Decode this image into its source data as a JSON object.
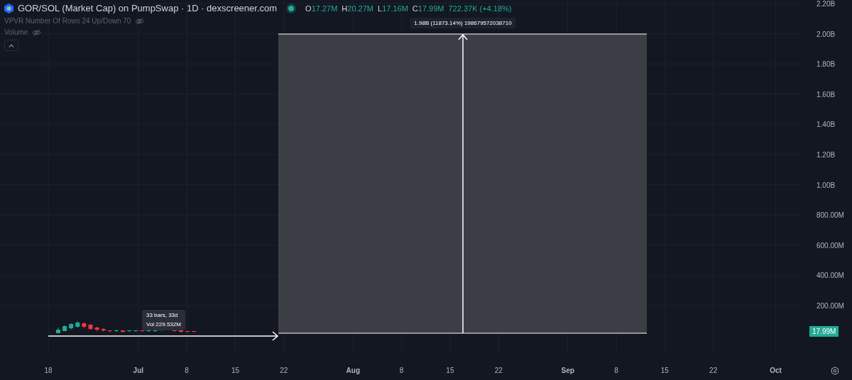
{
  "legend": {
    "title": "GOR/SOL (Market Cap) on PumpSwap · 1D · dexscreener.com",
    "ohlc": [
      {
        "label": "O",
        "value": "17.27M"
      },
      {
        "label": "H",
        "value": "20.27M"
      },
      {
        "label": "L",
        "value": "17.16M"
      },
      {
        "label": "C",
        "value": "17.99M"
      }
    ],
    "change": "722.37K (+4.18%)",
    "indicators": [
      "VPVR Number Of Rows 24 Up/Down 70",
      "Volume"
    ]
  },
  "measure": {
    "label": "1.98B (11873.14%) 198679572038710",
    "range_tooltip": [
      "33 bars, 33d",
      "Vol 229.532M"
    ]
  },
  "price_axis": {
    "ticks": [
      "2.20B",
      "2.00B",
      "1.80B",
      "1.60B",
      "1.40B",
      "1.20B",
      "1.00B",
      "800.00M",
      "600.00M",
      "400.00M",
      "200.00M"
    ],
    "last_price": "17.99M"
  },
  "time_axis": {
    "ticks": [
      {
        "label": "18",
        "kind": "day"
      },
      {
        "label": "Jul",
        "kind": "month"
      },
      {
        "label": "8",
        "kind": "day"
      },
      {
        "label": "15",
        "kind": "day"
      },
      {
        "label": "22",
        "kind": "day"
      },
      {
        "label": "Aug",
        "kind": "month"
      },
      {
        "label": "8",
        "kind": "day"
      },
      {
        "label": "15",
        "kind": "day"
      },
      {
        "label": "22",
        "kind": "day"
      },
      {
        "label": "Sep",
        "kind": "month"
      },
      {
        "label": "8",
        "kind": "day"
      },
      {
        "label": "15",
        "kind": "day"
      },
      {
        "label": "22",
        "kind": "day"
      },
      {
        "label": "Oct",
        "kind": "month"
      }
    ]
  }
}
